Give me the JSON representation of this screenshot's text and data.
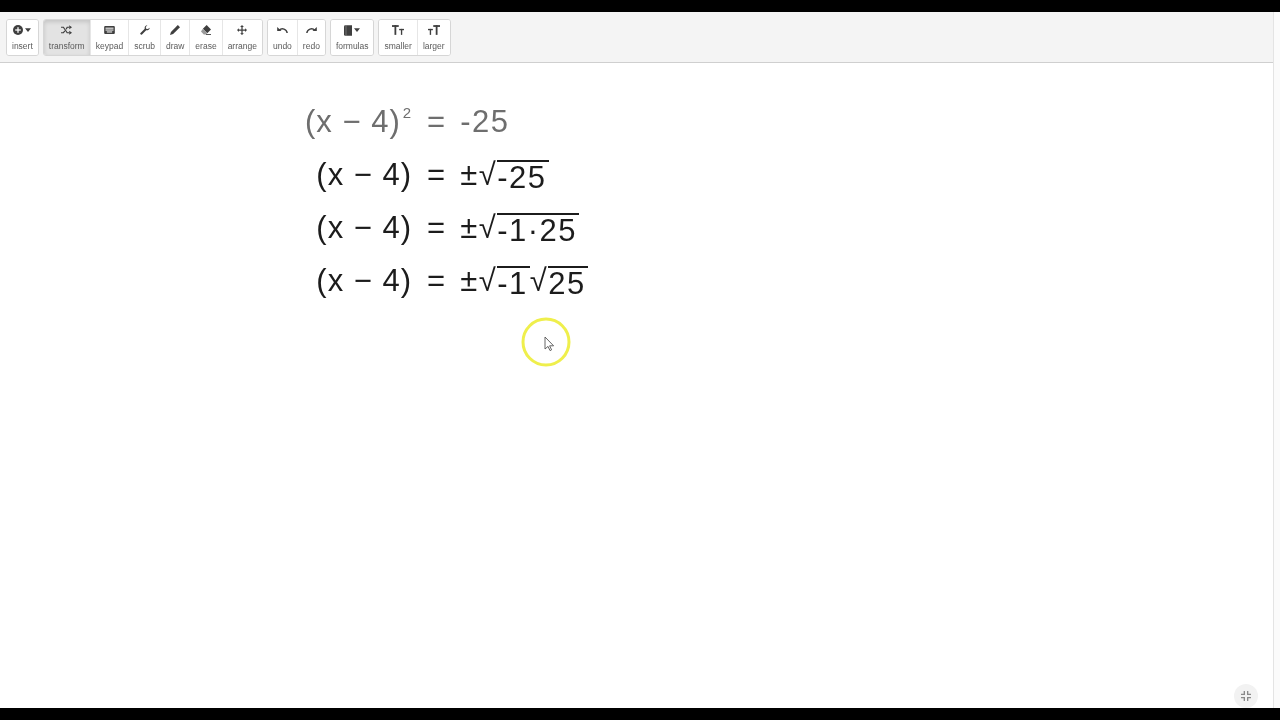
{
  "toolbar": {
    "groups": [
      {
        "tools": [
          {
            "label": "insert",
            "dropdown": true,
            "selected": false
          }
        ]
      },
      {
        "tools": [
          {
            "label": "transform",
            "dropdown": false,
            "selected": true
          },
          {
            "label": "keypad",
            "dropdown": false,
            "selected": false
          },
          {
            "label": "scrub",
            "dropdown": false,
            "selected": false
          },
          {
            "label": "draw",
            "dropdown": false,
            "selected": false
          },
          {
            "label": "erase",
            "dropdown": false,
            "selected": false
          },
          {
            "label": "arrange",
            "dropdown": false,
            "selected": false
          }
        ]
      },
      {
        "tools": [
          {
            "label": "undo",
            "dropdown": false,
            "selected": false
          },
          {
            "label": "redo",
            "dropdown": false,
            "selected": false
          }
        ]
      },
      {
        "tools": [
          {
            "label": "formulas",
            "dropdown": true,
            "selected": false
          }
        ]
      },
      {
        "tools": [
          {
            "label": "smaller",
            "dropdown": false,
            "selected": false
          },
          {
            "label": "larger",
            "dropdown": false,
            "selected": false
          }
        ]
      }
    ]
  },
  "expressions": [
    {
      "lhs": "(x − 4)",
      "exponent": "2",
      "relation": "=",
      "rhs": [
        {
          "kind": "text",
          "text": "-25"
        }
      ],
      "dimmed": true
    },
    {
      "lhs": "(x − 4)",
      "relation": "=",
      "rhs": [
        {
          "kind": "text",
          "text": "±√"
        },
        {
          "kind": "radicand",
          "text": "-25"
        }
      ],
      "dimmed": false
    },
    {
      "lhs": "(x − 4)",
      "relation": "=",
      "rhs": [
        {
          "kind": "text",
          "text": "±√"
        },
        {
          "kind": "radicand",
          "text": "-1·25"
        }
      ],
      "dimmed": false
    },
    {
      "lhs": "(x − 4)",
      "relation": "=",
      "rhs": [
        {
          "kind": "text",
          "text": "±√"
        },
        {
          "kind": "radicand",
          "text": "-1"
        },
        {
          "kind": "text",
          "text": "√"
        },
        {
          "kind": "radicand",
          "text": "25"
        }
      ],
      "dimmed": false
    }
  ]
}
